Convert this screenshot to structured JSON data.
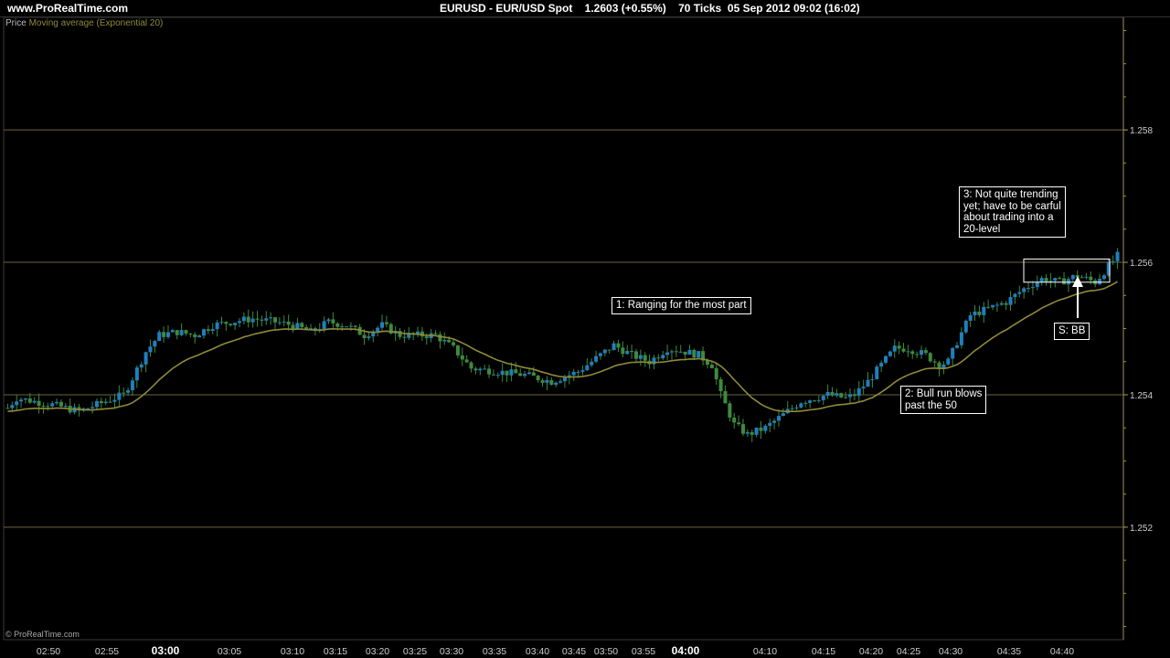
{
  "header": {
    "site": "www.ProRealTime.com",
    "instrument": "EURUSD - EUR/USD Spot    1.2603 (+0.55%)    70 Ticks  05 Sep 2012 09:02 (16:02)"
  },
  "legend": {
    "price_label": "Price",
    "ma_label": "Moving average (Exponential 20)"
  },
  "footer": {
    "copyright": "© ProRealTime.com"
  },
  "colors": {
    "bull": "#1f7fbf",
    "bear": "#3e8a3e",
    "ma": "#8f8a3a",
    "grid": "#6b6440",
    "axis": "#a09050",
    "annotation_border": "#ffffff",
    "arrow": "#ffffff"
  },
  "annotations": [
    {
      "id": "ann-1",
      "text": "1: Ranging for the most part"
    },
    {
      "id": "ann-2",
      "text": "2: Bull run blows\npast the 50"
    },
    {
      "id": "ann-3",
      "text": "3: Not quite trending\nyet; have to be carful\nabout trading into a\n20-level"
    },
    {
      "id": "ann-4",
      "text": "S: BB"
    }
  ],
  "chart_data": {
    "type": "candlestick",
    "ylim": [
      1.2503,
      1.2597
    ],
    "y_ticks": [
      "1.258",
      "1.256",
      "1.254",
      "1.252"
    ],
    "x_ticks": [
      {
        "label": "02:50",
        "bold": false
      },
      {
        "label": "02:55",
        "bold": false
      },
      {
        "label": "03:00",
        "bold": true
      },
      {
        "label": "03:05",
        "bold": false
      },
      {
        "label": "03:10",
        "bold": false
      },
      {
        "label": "03:15",
        "bold": false
      },
      {
        "label": "03:20",
        "bold": false
      },
      {
        "label": "03:25",
        "bold": false
      },
      {
        "label": "03:30",
        "bold": false
      },
      {
        "label": "03:35",
        "bold": false
      },
      {
        "label": "03:40",
        "bold": false
      },
      {
        "label": "03:45",
        "bold": false
      },
      {
        "label": "03:50",
        "bold": false
      },
      {
        "label": "03:55",
        "bold": false
      },
      {
        "label": "04:00",
        "bold": true
      },
      {
        "label": "04:10",
        "bold": false
      },
      {
        "label": "04:15",
        "bold": false
      },
      {
        "label": "04:20",
        "bold": false
      },
      {
        "label": "04:25",
        "bold": false
      },
      {
        "label": "04:30",
        "bold": false
      },
      {
        "label": "04:35",
        "bold": false
      },
      {
        "label": "04:40",
        "bold": false
      }
    ],
    "price_anchors": [
      [
        0,
        1.2538
      ],
      [
        2,
        1.25395
      ],
      [
        10,
        1.25385
      ],
      [
        16,
        1.25375
      ],
      [
        22,
        1.2539
      ],
      [
        26,
        1.254
      ],
      [
        28,
        1.25425
      ],
      [
        31,
        1.25465
      ],
      [
        34,
        1.2549
      ],
      [
        38,
        1.25495
      ],
      [
        42,
        1.2549
      ],
      [
        46,
        1.25505
      ],
      [
        50,
        1.2551
      ],
      [
        55,
        1.25515
      ],
      [
        60,
        1.2551
      ],
      [
        64,
        1.25505
      ],
      [
        68,
        1.25495
      ],
      [
        72,
        1.2551
      ],
      [
        76,
        1.25505
      ],
      [
        80,
        1.2549
      ],
      [
        84,
        1.25505
      ],
      [
        88,
        1.2549
      ],
      [
        96,
        1.2549
      ],
      [
        100,
        1.2547
      ],
      [
        104,
        1.2544
      ],
      [
        110,
        1.25435
      ],
      [
        116,
        1.2543
      ],
      [
        122,
        1.2542
      ],
      [
        128,
        1.25435
      ],
      [
        132,
        1.25455
      ],
      [
        136,
        1.25475
      ],
      [
        140,
        1.2546
      ],
      [
        144,
        1.2545
      ],
      [
        148,
        1.2547
      ],
      [
        152,
        1.25465
      ],
      [
        155,
        1.2546
      ],
      [
        158,
        1.25445
      ],
      [
        160,
        1.254
      ],
      [
        163,
        1.25355
      ],
      [
        166,
        1.2534
      ],
      [
        170,
        1.2535
      ],
      [
        174,
        1.2537
      ],
      [
        178,
        1.2539
      ],
      [
        184,
        1.254
      ],
      [
        188,
        1.25395
      ],
      [
        190,
        1.254
      ],
      [
        193,
        1.2542
      ],
      [
        196,
        1.25445
      ],
      [
        199,
        1.2547
      ],
      [
        202,
        1.2547
      ],
      [
        206,
        1.2546
      ],
      [
        209,
        1.25445
      ],
      [
        211,
        1.2545
      ],
      [
        213,
        1.2548
      ],
      [
        216,
        1.2552
      ],
      [
        220,
        1.2553
      ],
      [
        224,
        1.2554
      ],
      [
        228,
        1.2556
      ],
      [
        232,
        1.25575
      ],
      [
        236,
        1.2557
      ],
      [
        240,
        1.2558
      ],
      [
        244,
        1.2557
      ],
      [
        249,
        1.2561
      ]
    ],
    "ema_period": 20
  }
}
